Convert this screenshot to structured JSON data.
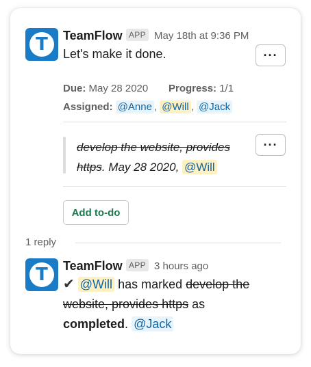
{
  "message": {
    "avatar_letter": "T",
    "author": "TeamFlow",
    "badge": "APP",
    "timestamp": "May 18th at 9:36 PM",
    "text": "Let's make it done.",
    "more_label": "···",
    "due_label": "Due:",
    "due_value": "May 28 2020",
    "progress_label": "Progress:",
    "progress_value": "1/1",
    "assigned_label": "Assigned:",
    "assignees": [
      "@Anne",
      "@Will",
      "@Jack"
    ],
    "separator": ",",
    "task": {
      "title_line1": "develop the website, provides",
      "title_line2": "https",
      "date": ". May 28 2020,",
      "assignee": "@Will",
      "more_label": "···"
    },
    "add_todo_label": "Add to-do"
  },
  "thread": {
    "reply_count": "1 reply"
  },
  "reply": {
    "avatar_letter": "T",
    "author": "TeamFlow",
    "badge": "APP",
    "timestamp": "3 hours ago",
    "check": "✔",
    "mention": "@Will",
    "text_before": "has marked",
    "struck_1": "develop the",
    "struck_2": "website, provides https",
    "text_after": "as",
    "completed": "completed",
    "period": ".",
    "mention_end": "@Jack"
  },
  "colors": {
    "avatar_bg": "#1a7cc7",
    "mention_blue": "#1264a3",
    "mention_bg": "#e8f4fb",
    "mention_yellow_bg": "#fdf0c2",
    "add_todo_text": "#1d7a4f"
  }
}
